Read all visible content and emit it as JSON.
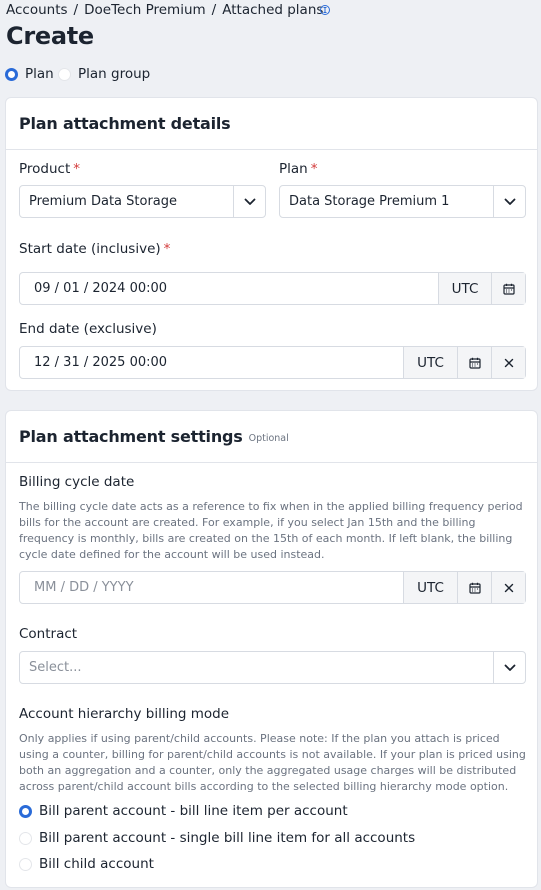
{
  "breadcrumb": {
    "accounts": "Accounts",
    "separator": "/",
    "account_name": "DoeTech Premium",
    "current": "Attached plans"
  },
  "page": {
    "title": "Create"
  },
  "attachment_type": {
    "options": [
      {
        "label": "Plan",
        "checked": true
      },
      {
        "label": "Plan group",
        "checked": false
      }
    ]
  },
  "details_card": {
    "title": "Plan attachment details",
    "required_marker": "*",
    "product": {
      "label": "Product",
      "value": "Premium Data Storage"
    },
    "plan": {
      "label": "Plan",
      "value": "Data Storage Premium 1"
    },
    "start_date": {
      "label": "Start date (inclusive)",
      "value": "09 / 01 / 2024 00:00",
      "timezone": "UTC"
    },
    "end_date": {
      "label": "End date (exclusive)",
      "value": "12 / 31 / 2025 00:00",
      "timezone": "UTC"
    }
  },
  "settings_card": {
    "title": "Plan attachment settings",
    "optional": "Optional",
    "billing_cycle": {
      "label": "Billing cycle date",
      "help": "The billing cycle date acts as a reference to fix when in the applied billing frequency period bills for the account are created. For example, if you select Jan 15th and the billing frequency is monthly, bills are created on the 15th of each month. If left blank, the billing cycle date defined for the account will be used instead.",
      "placeholder": "MM / DD / YYYY",
      "timezone": "UTC"
    },
    "contract": {
      "label": "Contract",
      "placeholder": "Select..."
    },
    "hierarchy": {
      "label": "Account hierarchy billing mode",
      "help": "Only applies if using parent/child accounts. Please note: If the plan you attach is priced using a counter, billing for parent/child accounts is not available. If your plan is priced using both an aggregation and a counter, only the aggregated usage charges will be distributed across parent/child account bills according to the selected billing hierarchy mode option.",
      "options": [
        {
          "label": "Bill parent account - bill line item per account",
          "checked": true
        },
        {
          "label": "Bill parent account - single bill line item for all accounts",
          "checked": false
        },
        {
          "label": "Bill child account",
          "checked": false
        }
      ]
    }
  },
  "icons": {
    "chevron": "chevron-down-icon",
    "calendar": "calendar-icon",
    "clear": "close-icon",
    "cursor": "text-cursor-icon"
  },
  "colors": {
    "accent": "#2a6bd8",
    "required": "#d33a3a",
    "border": "#d7dbe2",
    "background": "#eef0f4"
  }
}
